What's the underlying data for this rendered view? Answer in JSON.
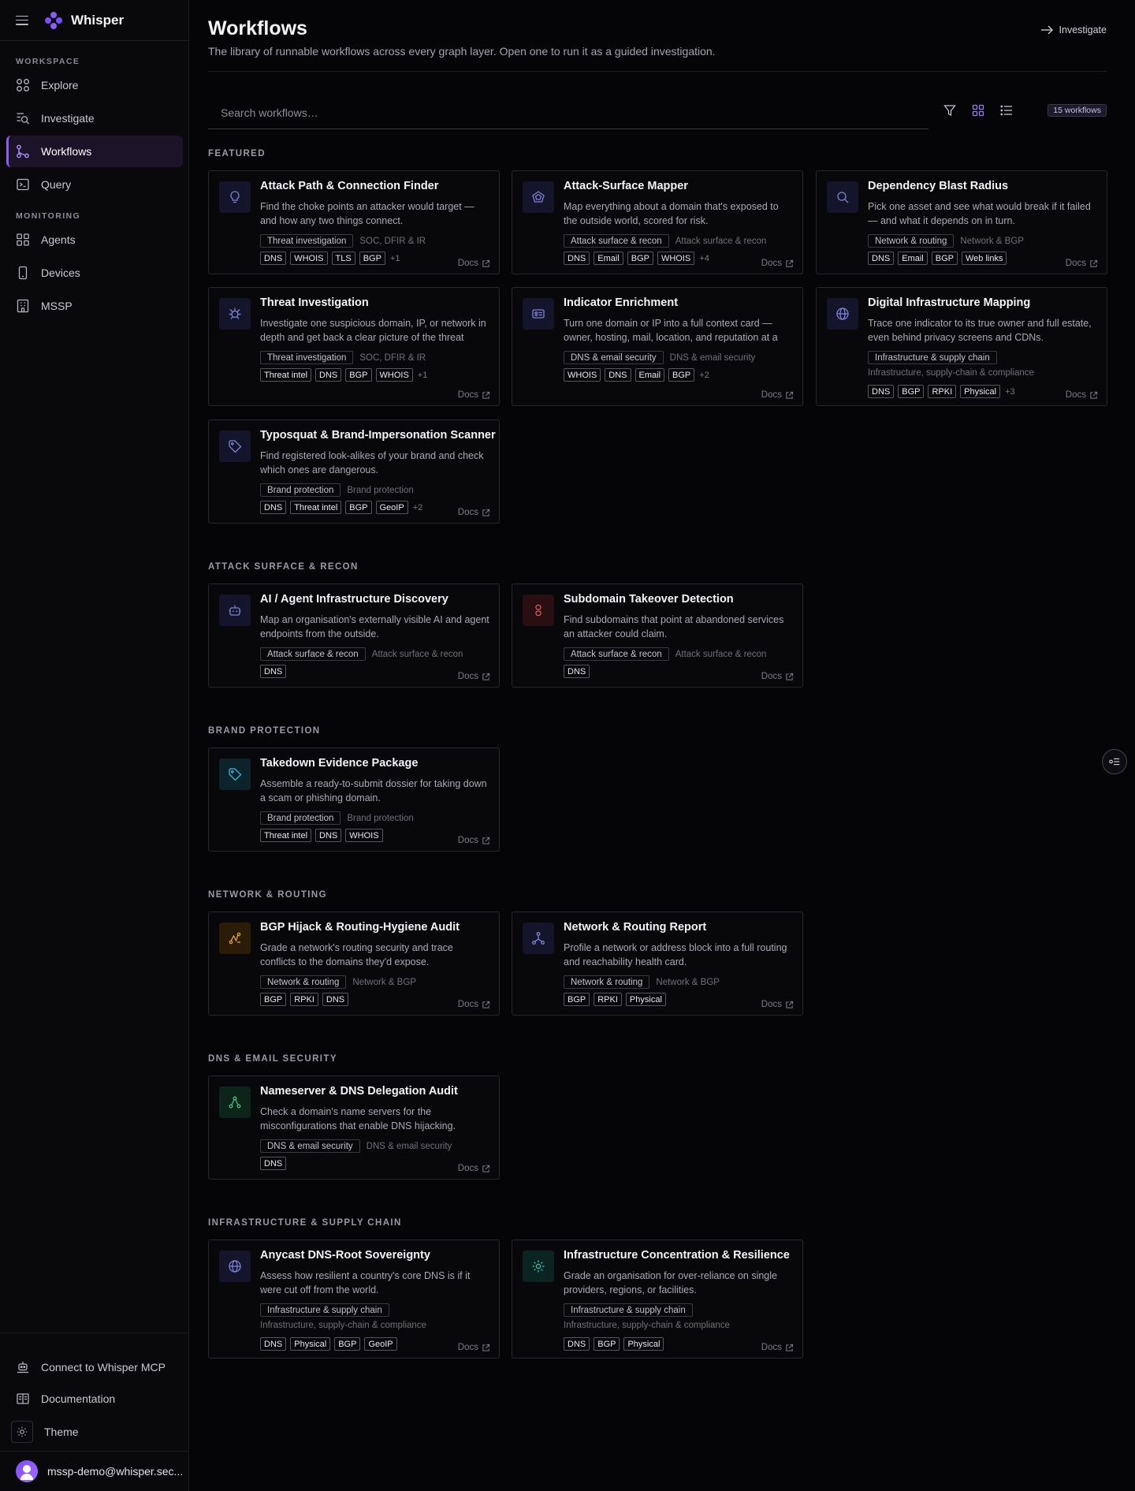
{
  "app": {
    "name": "Whisper"
  },
  "sidebar": {
    "workspace_label": "WORKSPACE",
    "monitoring_label": "MONITORING",
    "items": [
      {
        "label": "Explore",
        "icon": "explore-icon"
      },
      {
        "label": "Investigate",
        "icon": "investigate-icon"
      },
      {
        "label": "Workflows",
        "icon": "workflows-icon",
        "active": true
      },
      {
        "label": "Query",
        "icon": "query-icon"
      },
      {
        "label": "Agents",
        "icon": "agents-icon"
      },
      {
        "label": "Devices",
        "icon": "devices-icon"
      },
      {
        "label": "MSSP",
        "icon": "mssp-icon"
      }
    ],
    "bottom": {
      "mcp": "Connect to Whisper MCP",
      "docs": "Documentation",
      "theme": "Theme",
      "user": "mssp-demo@whisper.sec..."
    }
  },
  "header": {
    "title": "Workflows",
    "subtitle": "The library of runnable workflows across every graph layer. Open one to run it as a guided investigation.",
    "investigate_label": "Investigate"
  },
  "search": {
    "placeholder": "Search workflows…",
    "value": ""
  },
  "count_badge": "15 workflows",
  "sections": {
    "featured": {
      "label": "FEATURED",
      "cards": [
        {
          "title": "Attack Path & Connection Finder",
          "desc": "Find the choke points an attacker would target — and how any two things connect.",
          "category": "Threat investigation",
          "subcategory": "SOC, DFIR & IR",
          "tags": [
            "DNS",
            "WHOIS",
            "TLS",
            "BGP"
          ],
          "more": "+1",
          "docs": "Docs",
          "icon": "lightbulb-icon",
          "icon_color": "#7b84d6"
        },
        {
          "title": "Attack-Surface Mapper",
          "desc": "Map everything about a domain that's exposed to the outside world, scored for risk.",
          "category": "Attack surface & recon",
          "subcategory": "Attack surface & recon",
          "tags": [
            "DNS",
            "Email",
            "BGP",
            "WHOIS"
          ],
          "more": "+4",
          "docs": "Docs",
          "icon": "pentagon-icon",
          "icon_color": "#7b84d6"
        },
        {
          "title": "Dependency Blast Radius",
          "desc": "Pick one asset and see what would break if it failed — and what it depends on in turn.",
          "category": "Network & routing",
          "subcategory": "Network & BGP",
          "tags": [
            "DNS",
            "Email",
            "BGP",
            "Web links"
          ],
          "more": "",
          "docs": "Docs",
          "icon": "search-icon",
          "icon_color": "#7b84d6"
        },
        {
          "title": "Threat Investigation",
          "desc": "Investigate one suspicious domain, IP, or network in depth and get back a clear picture of the threat and...",
          "category": "Threat investigation",
          "subcategory": "SOC, DFIR & IR",
          "tags": [
            "Threat intel",
            "DNS",
            "BGP",
            "WHOIS"
          ],
          "more": "+1",
          "docs": "Docs",
          "icon": "bug-icon",
          "icon_color": "#7b84d6"
        },
        {
          "title": "Indicator Enrichment",
          "desc": "Turn one domain or IP into a full context card — owner, hosting, mail, location, and reputation at a glance.",
          "category": "DNS & email security",
          "subcategory": "DNS & email security",
          "tags": [
            "WHOIS",
            "DNS",
            "Email",
            "BGP"
          ],
          "more": "+2",
          "docs": "Docs",
          "icon": "id-card-icon",
          "icon_color": "#7b84d6"
        },
        {
          "title": "Digital Infrastructure Mapping",
          "desc": "Trace one indicator to its true owner and full estate, even behind privacy screens and CDNs.",
          "category": "Infrastructure & supply chain",
          "subcategory": "Infrastructure, supply-chain & compliance",
          "tags": [
            "DNS",
            "BGP",
            "RPKI",
            "Physical"
          ],
          "more": "+3",
          "docs": "Docs",
          "icon": "globe-icon",
          "icon_color": "#7b84d6"
        },
        {
          "title": "Typosquat & Brand-Impersonation Scanner",
          "desc": "Find registered look-alikes of your brand and check which ones are dangerous.",
          "category": "Brand protection",
          "subcategory": "Brand protection",
          "tags": [
            "DNS",
            "Threat intel",
            "BGP",
            "GeoIP"
          ],
          "more": "+2",
          "docs": "Docs",
          "icon": "tag-icon",
          "icon_color": "#7b84d6"
        }
      ]
    },
    "attack_surface": {
      "label": "ATTACK SURFACE & RECON",
      "cards": [
        {
          "title": "AI / Agent Infrastructure Discovery",
          "desc": "Map an organisation's externally visible AI and agent endpoints from the outside.",
          "category": "Attack surface & recon",
          "subcategory": "Attack surface & recon",
          "tags": [
            "DNS"
          ],
          "more": "",
          "docs": "Docs",
          "icon": "robot-icon",
          "icon_color": "#7b84d6"
        },
        {
          "title": "Subdomain Takeover Detection",
          "desc": "Find subdomains that point at abandoned services an attacker could claim.",
          "category": "Attack surface & recon",
          "subcategory": "Attack surface & recon",
          "tags": [
            "DNS"
          ],
          "more": "",
          "docs": "Docs",
          "icon": "broken-link-icon",
          "icon_color": "#e0565b"
        }
      ]
    },
    "brand": {
      "label": "BRAND PROTECTION",
      "cards": [
        {
          "title": "Takedown Evidence Package",
          "desc": "Assemble a ready-to-submit dossier for taking down a scam or phishing domain.",
          "category": "Brand protection",
          "subcategory": "Brand protection",
          "tags": [
            "Threat intel",
            "DNS",
            "WHOIS"
          ],
          "more": "",
          "docs": "Docs",
          "icon": "tag-icon",
          "icon_color": "#37b7d6"
        }
      ]
    },
    "network": {
      "label": "NETWORK & ROUTING",
      "cards": [
        {
          "title": "BGP Hijack & Routing-Hygiene Audit",
          "desc": "Grade a network's routing security and trace conflicts to the domains they'd expose.",
          "category": "Network & routing",
          "subcategory": "Network & BGP",
          "tags": [
            "BGP",
            "RPKI",
            "DNS"
          ],
          "more": "",
          "docs": "Docs",
          "icon": "route-icon",
          "icon_color": "#e3a33a"
        },
        {
          "title": "Network & Routing Report",
          "desc": "Profile a network or address block into a full routing and reachability health card.",
          "category": "Network & routing",
          "subcategory": "Network & BGP",
          "tags": [
            "BGP",
            "RPKI",
            "Physical"
          ],
          "more": "",
          "docs": "Docs",
          "icon": "network-icon",
          "icon_color": "#7b84d6"
        }
      ]
    },
    "dns": {
      "label": "DNS & EMAIL SECURITY",
      "cards": [
        {
          "title": "Nameserver & DNS Delegation Audit",
          "desc": "Check a domain's name servers for the misconfigurations that enable DNS hijacking.",
          "category": "DNS & email security",
          "subcategory": "DNS & email security",
          "tags": [
            "DNS"
          ],
          "more": "",
          "docs": "Docs",
          "icon": "nodes-icon",
          "icon_color": "#3fbf7f"
        }
      ]
    },
    "infra": {
      "label": "INFRASTRUCTURE & SUPPLY CHAIN",
      "cards": [
        {
          "title": "Anycast DNS-Root Sovereignty",
          "desc": "Assess how resilient a country's core DNS is if it were cut off from the world.",
          "category": "Infrastructure & supply chain",
          "subcategory": "Infrastructure, supply-chain & compliance",
          "tags": [
            "DNS",
            "Physical",
            "BGP",
            "GeoIP"
          ],
          "more": "",
          "docs": "Docs",
          "icon": "globe-icon",
          "icon_color": "#7b84d6"
        },
        {
          "title": "Infrastructure Concentration & Resilience",
          "desc": "Grade an organisation for over-reliance on single providers, regions, or facilities.",
          "category": "Infrastructure & supply chain",
          "subcategory": "Infrastructure, supply-chain & compliance",
          "tags": [
            "DNS",
            "BGP",
            "Physical"
          ],
          "more": "",
          "docs": "Docs",
          "icon": "sun-icon",
          "icon_color": "#35c2a8"
        }
      ]
    }
  }
}
